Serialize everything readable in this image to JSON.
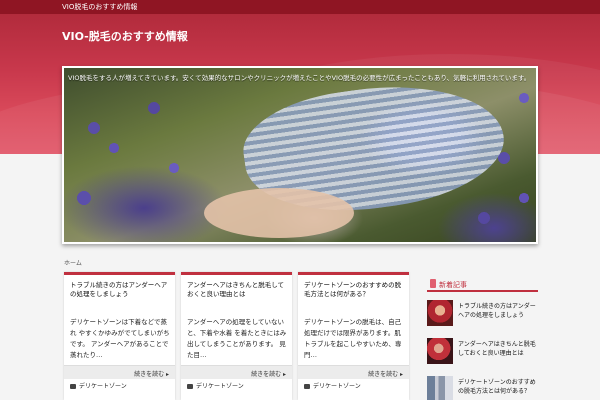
{
  "topbar": {
    "text": "VIO脱毛のおすすめ情報"
  },
  "header": {
    "site_title": "VIO-脱毛のおすすめ情報"
  },
  "hero": {
    "caption": "VIO脱毛をする人が増えてきています。安くて効果的なサロンやクリニックが増えたことやVIO脱毛の必要性が広まったこともあり、気軽に利用されています。"
  },
  "breadcrumb": {
    "label": "ホーム"
  },
  "cards": [
    {
      "title": "トラブル続きの方はアンダーヘアの処理をしましょう",
      "text": "デリケートゾーンは下着などで蒸れ やすくかゆみがでてしまいがちです。 アンダーヘアがあることで蒸れたり…",
      "more": "続きを読む",
      "category": "デリケートゾーン"
    },
    {
      "title": "アンダーヘアはきちんと脱毛しておくと良い理由とは",
      "text": "アンダーヘアの処理をしていないと、下着や水着 を着たときにはみ出してしまうことがあります。 見た目…",
      "more": "続きを読む",
      "category": "デリケートゾーン"
    },
    {
      "title": "デリケートゾーンのおすすめの脱毛方法とは何がある？",
      "text": "デリケートゾーンの脱毛は、自己処理だけでは限界があります。肌トラブルを起こしやすいため、専門…",
      "more": "続きを読む",
      "category": "デリケートゾーン"
    }
  ],
  "sidebar": {
    "heading": "新着記事",
    "items": [
      {
        "title": "トラブル続きの方はアンダーヘアの処理をしましょう"
      },
      {
        "title": "アンダーヘアはきちんと脱毛しておくと良い理由とは"
      },
      {
        "title": "デリケートゾーンのおすすめの脱毛方法とは何がある？"
      }
    ]
  },
  "colors": {
    "accent": "#c0303f",
    "topbar": "#8f1523",
    "header": "#c8384c"
  }
}
